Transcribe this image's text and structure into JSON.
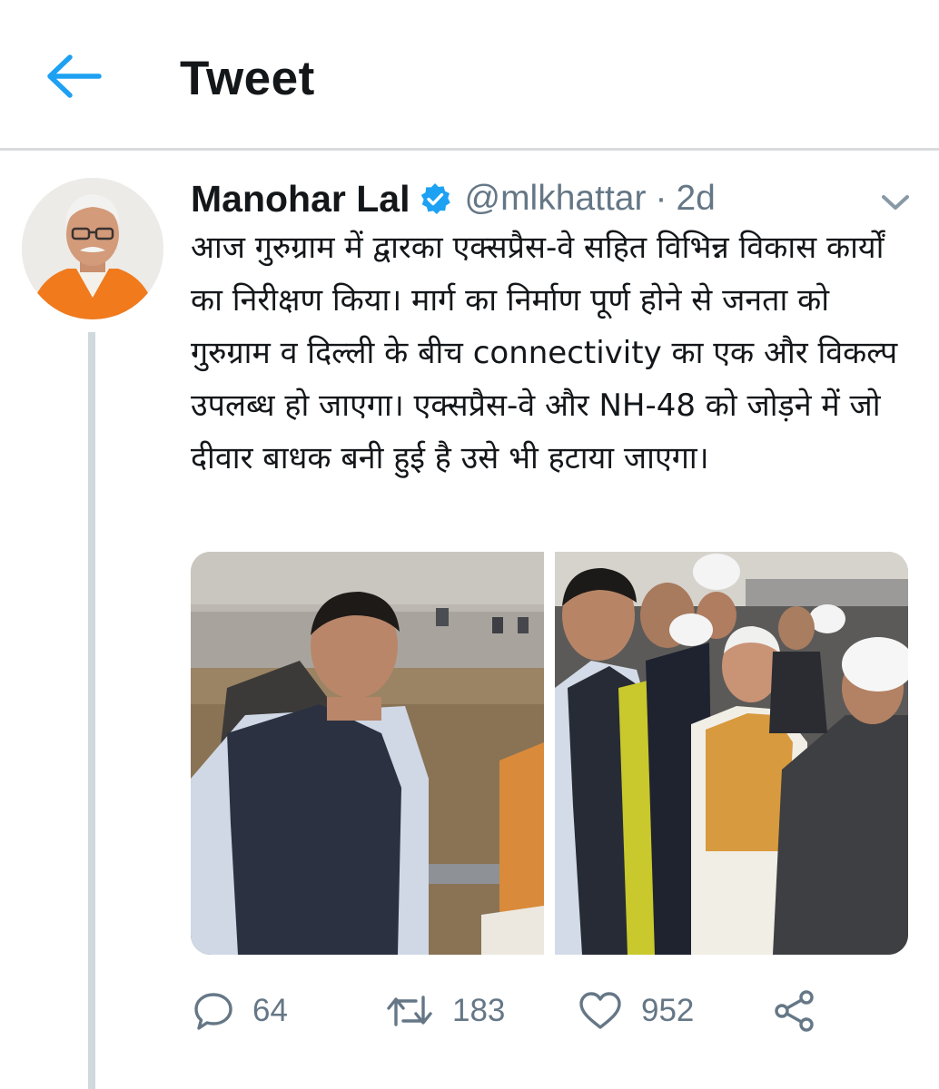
{
  "header": {
    "title": "Tweet",
    "back_icon": "arrow-left-icon"
  },
  "tweet": {
    "author": {
      "display_name": "Manohar Lal",
      "handle": "@mlkhattar",
      "verified": true
    },
    "separator": "·",
    "time": "2d",
    "text": "आज गुरुग्राम में द्वारका एक्सप्रैस-वे सहित विभिन्न विकास कार्यों का निरीक्षण किया। मार्ग का निर्माण पूर्ण होने से जनता को गुरुग्राम व दिल्ली के बीच connectivity का एक और विकल्प उपलब्ध हो जाएगा। एक्सप्रैस-वे और NH-48 को जोड़ने में जो दीवार बाधक बनी हुई है उसे भी हटाया जाएगा।",
    "media_count": 2,
    "stats": {
      "replies": "64",
      "retweets": "183",
      "likes": "952"
    }
  },
  "colors": {
    "accent": "#1da1f2",
    "secondary_text": "#657786",
    "primary_text": "#14171a",
    "divider": "#d8dcdf",
    "thread_line": "#cfd9de"
  }
}
